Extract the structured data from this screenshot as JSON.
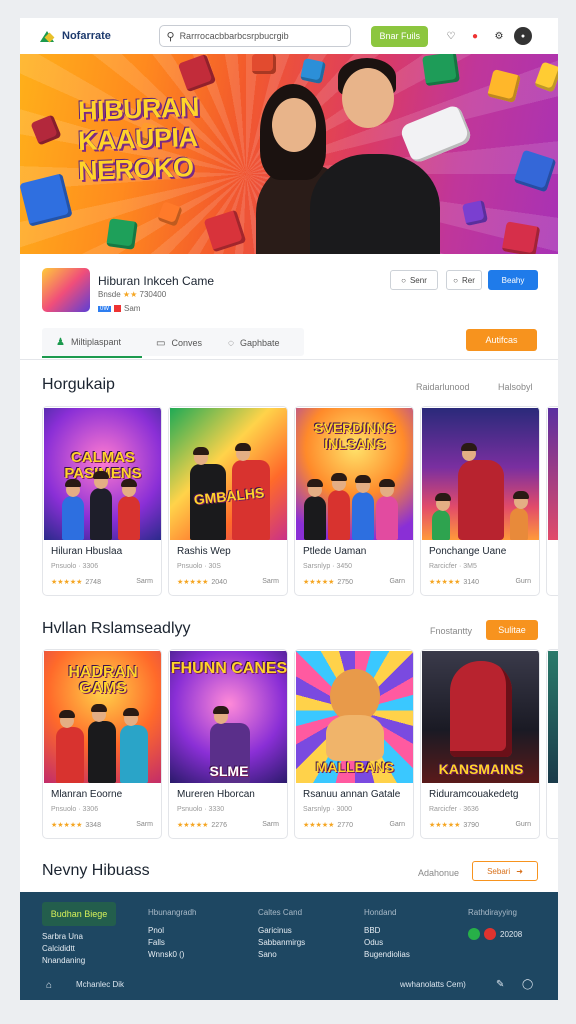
{
  "brand": {
    "name": "Nofarrate"
  },
  "search": {
    "text": "Rarrrocacbbarbcsrpbucrgib"
  },
  "header": {
    "cta_label": "Bnar Fuils"
  },
  "hero": {
    "title_lines": [
      "HIBURAN",
      "KAAUPIA",
      "NEROKO"
    ]
  },
  "game": {
    "title": "Hiburan Inkceh Came",
    "meta_left": "Bnsde",
    "meta_stars": "★★",
    "meta_right": "730400",
    "tag_badge": "0W",
    "tag_text": "Sam",
    "buttons": [
      "Senr",
      "Rer",
      "Beahy"
    ]
  },
  "tabs": [
    {
      "label": "Miltiplaspant"
    },
    {
      "label": "Conves"
    },
    {
      "label": "Gaphbate"
    }
  ],
  "tabs_action": "Autifcas",
  "section1": {
    "title": "Horgukaip",
    "link1": "Raidarlunood",
    "link2": "Halsobyl",
    "cards": [
      {
        "art": "CALMAS PASIMENS",
        "title": "Hiluran Hbuslaa",
        "sub": "Pnsuolo · 3306",
        "stars": "★★★★★",
        "num": "2748",
        "tag": "Sarm"
      },
      {
        "art": "GMBALHS",
        "title": "Rashis Wep",
        "sub": "Pnsuolo · 30S",
        "stars": "★★★★★",
        "num": "2040",
        "tag": "Sarm"
      },
      {
        "art": "SVERDINNS INLSANS",
        "title": "Ptlede Uaman",
        "sub": "Sarsnlyp · 3450",
        "stars": "★★★★★",
        "num": "2750",
        "tag": "Garn"
      },
      {
        "art": "",
        "title": "Ponchange Uane",
        "sub": "Rarcicfer · 3M5",
        "stars": "★★★★★",
        "num": "3140",
        "tag": "Gurn"
      }
    ]
  },
  "section2": {
    "title": "Hvllan Rslamseadlyy",
    "link1": "Fnostantty",
    "button": "Sulitae",
    "cards": [
      {
        "art": "HADRAN GAMS",
        "title": "Mlanran Eoorne",
        "sub": "Pnsuolo · 3306",
        "stars": "★★★★★",
        "num": "3348",
        "tag": "Sarm"
      },
      {
        "art": "FHUNN CANES",
        "art2": "SLME",
        "title": "Mureren Hborcan",
        "sub": "Psnuolo · 3330",
        "stars": "★★★★★",
        "num": "2276",
        "tag": "Sarm"
      },
      {
        "art": "MALLBANS",
        "title": "Rsanuu annan Gatale",
        "sub": "Sarsnlyp · 3000",
        "stars": "★★★★★",
        "num": "2770",
        "tag": "Garn"
      },
      {
        "art": "KANSMAINS",
        "title": "Riduramcouakedetg",
        "sub": "Rarcicfer · 3636",
        "stars": "★★★★★",
        "num": "3790",
        "tag": "Gurn"
      }
    ]
  },
  "section3": {
    "title": "Nevny Hibuass",
    "link1": "Adahonue",
    "button": "Sebari"
  },
  "footer": {
    "badge": "Budhan Biege",
    "columns": [
      {
        "heading": "Hbunangradh",
        "items": [
          "Sarbra Una",
          "Calcididtt",
          "Nnandaning"
        ]
      },
      {
        "heading": "Hbunangradh",
        "items": [
          "Pnol",
          "Falls",
          "Wnnsk0 ()"
        ]
      },
      {
        "heading": "Caltes Cand",
        "items": [
          "Garicinus",
          "Sabbanmirgs",
          "Sano"
        ]
      },
      {
        "heading": "Hondand",
        "items": [
          "BBD",
          "Odus",
          "Bugendiolias"
        ]
      },
      {
        "heading": "Rathdirayying",
        "items": [
          "20208"
        ]
      }
    ],
    "bottom_left": "Mchanlec Dik",
    "bottom_right": "wwhanolatts Cem)"
  },
  "colors": {
    "accent_green": "#8cc63f",
    "accent_blue": "#1f7bea",
    "accent_orange": "#f7931e",
    "footer_bg": "#1e4762"
  }
}
